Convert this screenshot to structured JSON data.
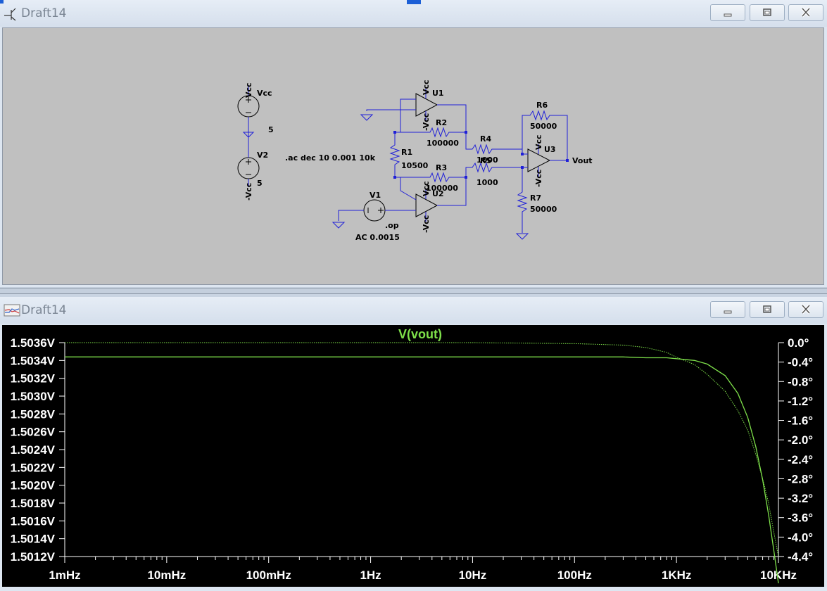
{
  "schematic_window": {
    "title": "Draft14",
    "icons": {
      "app": "schematic-icon",
      "minimize": "minimize-icon",
      "maximize": "maximize-icon",
      "close": "close-icon"
    }
  },
  "schematic": {
    "labels": {
      "vcc_top": "Vcc",
      "vcc_label": "Vcc",
      "v2_value_top": "5",
      "v2": "V2",
      "vcc_neg": "-Vcc",
      "v2_value": "5",
      "ac_directive": ".ac dec 10 0.001 10k",
      "u1_vcc": "Vcc",
      "u1": "U1",
      "u1_neg": "-Vcc",
      "r2": "R2",
      "r2_val": "100000",
      "r1": "R1",
      "r1_val": "10500",
      "r3": "R3",
      "r3_val": "100000",
      "u2_vcc": "Vcc",
      "u2": "U2",
      "u2_neg": "-Vcc",
      "v1": "V1",
      "op_directive": ".op",
      "v1_ac": "AC 0.0015",
      "r4": "R4",
      "r4_val": "1000",
      "r5": "R5",
      "r5_val": "1000",
      "r6": "R6",
      "r6_val": "50000",
      "u3_vcc": "Vcc",
      "u3": "U3",
      "u3_neg": "-Vcc",
      "vout": "Vout",
      "r7": "R7",
      "r7_val": "50000"
    }
  },
  "plot_window": {
    "title": "Draft14",
    "icons": {
      "app": "waveform-icon",
      "minimize": "minimize-icon",
      "maximize": "maximize-icon",
      "close": "close-icon"
    }
  },
  "colors": {
    "trace": "#7ee04a",
    "phase_trace": "#7ee04a",
    "axis_text": "#ffffff",
    "background": "#000000"
  },
  "chart_data": {
    "type": "line",
    "title": "V(vout)",
    "x_scale": "log",
    "x_ticks": [
      "1mHz",
      "10mHz",
      "100mHz",
      "1Hz",
      "10Hz",
      "100Hz",
      "1KHz",
      "10KHz"
    ],
    "x_tick_values": [
      0.001,
      0.01,
      0.1,
      1,
      10,
      100,
      1000,
      10000
    ],
    "xlim": [
      0.001,
      10000
    ],
    "y_left_ticks": [
      "1.5036V",
      "1.5034V",
      "1.5032V",
      "1.5030V",
      "1.5028V",
      "1.5026V",
      "1.5024V",
      "1.5022V",
      "1.5020V",
      "1.5018V",
      "1.5016V",
      "1.5014V",
      "1.5012V"
    ],
    "y_left_lim": [
      1.5012,
      1.5036
    ],
    "y_right_ticks": [
      "0.0°",
      "-0.4°",
      "-0.8°",
      "-1.2°",
      "-1.6°",
      "-2.0°",
      "-2.4°",
      "-2.8°",
      "-3.2°",
      "-3.6°",
      "-4.0°",
      "-4.4°"
    ],
    "y_right_lim": [
      -4.4,
      0.0
    ],
    "series": [
      {
        "name": "V(vout)",
        "axis": "left",
        "x": [
          0.001,
          0.01,
          0.1,
          1,
          10,
          100,
          300,
          500,
          800,
          1000,
          1500,
          2000,
          3000,
          4000,
          5000,
          6000,
          7000,
          8000,
          9000,
          10000
        ],
        "values": [
          1.50344,
          1.50344,
          1.50344,
          1.50344,
          1.50344,
          1.50344,
          1.50344,
          1.50343,
          1.50343,
          1.50342,
          1.5034,
          1.50336,
          1.50323,
          1.50303,
          1.50276,
          1.50243,
          1.50206,
          1.50167,
          1.50127,
          1.5009
        ]
      },
      {
        "name": "phase",
        "axis": "right",
        "x": [
          0.001,
          0.01,
          0.1,
          1,
          10,
          100,
          300,
          500,
          800,
          1000,
          1500,
          2000,
          3000,
          4000,
          5000,
          6000,
          7000,
          8000,
          9000,
          10000
        ],
        "values": [
          0.0,
          0.0,
          0.0,
          0.0,
          0.0,
          -0.02,
          -0.05,
          -0.1,
          -0.2,
          -0.3,
          -0.45,
          -0.65,
          -1.0,
          -1.4,
          -1.8,
          -2.3,
          -2.8,
          -3.3,
          -3.9,
          -4.4
        ]
      }
    ]
  }
}
